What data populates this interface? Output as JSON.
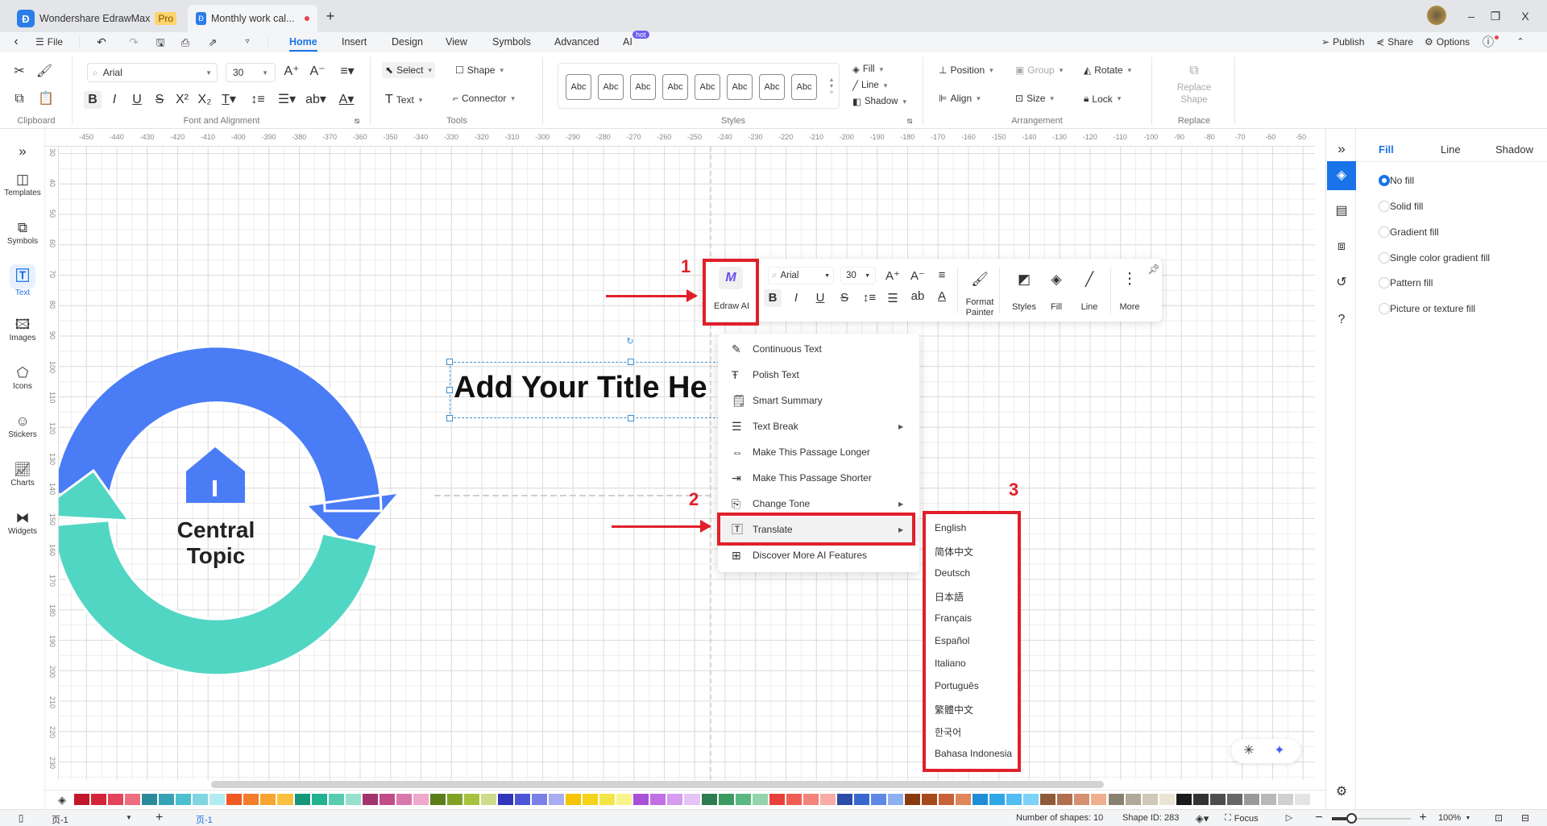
{
  "titlebar": {
    "app_name": "Wondershare EdrawMax",
    "pro_badge": "Pro",
    "doc_tab": "Monthly work cal...",
    "new_tab": "+",
    "minimize": "–",
    "maximize": "❐",
    "close": "X"
  },
  "menubar": {
    "file": "File",
    "tabs": [
      "Home",
      "Insert",
      "Design",
      "View",
      "Symbols",
      "Advanced",
      "AI"
    ],
    "active_tab": "Home",
    "ai_badge": "hot",
    "publish": "Publish",
    "share": "Share",
    "options": "Options"
  },
  "ribbon": {
    "groups": {
      "clipboard": "Clipboard",
      "font": "Font and Alignment",
      "tools": "Tools",
      "styles": "Styles",
      "arrangement": "Arrangement",
      "replace": "Replace"
    },
    "font_name": "Arial",
    "font_size": "30",
    "tools": {
      "select": "Select",
      "shape": "Shape",
      "text": "Text",
      "connector": "Connector"
    },
    "style_swatches": [
      "Abc",
      "Abc",
      "Abc",
      "Abc",
      "Abc",
      "Abc",
      "Abc",
      "Abc"
    ],
    "fill": "Fill",
    "line": "Line",
    "shadow": "Shadow",
    "arrangement": {
      "position": "Position",
      "group": "Group",
      "rotate": "Rotate",
      "align": "Align",
      "size": "Size",
      "lock": "Lock"
    },
    "replace_shape": "Replace Shape"
  },
  "left_sidebar": {
    "items": [
      {
        "label": "Templates"
      },
      {
        "label": "Symbols"
      },
      {
        "label": "Text"
      },
      {
        "label": "Images"
      },
      {
        "label": "Icons"
      },
      {
        "label": "Stickers"
      },
      {
        "label": "Charts"
      },
      {
        "label": "Widgets"
      }
    ],
    "active": "Text"
  },
  "rulers": {
    "horizontal": [
      -450,
      -440,
      -430,
      -420,
      -410,
      -400,
      -390,
      -380,
      -370,
      -360,
      -350,
      -340,
      -330,
      -320,
      -310,
      -300,
      -290,
      -280,
      -270,
      -260,
      -250,
      -240,
      -230,
      -220,
      -210,
      -200,
      -190,
      -180,
      -170,
      -160,
      -150,
      -140,
      -130,
      -120,
      -110,
      -100,
      -90,
      -80,
      -70,
      -60,
      -50
    ],
    "vertical": [
      30,
      40,
      50,
      60,
      70,
      80,
      90,
      100,
      110,
      120,
      130,
      140,
      150,
      160,
      170,
      180,
      190,
      200,
      210,
      220,
      230
    ]
  },
  "canvas": {
    "title_text": "Add Your Title He",
    "central_topic": "Central Topic",
    "colors": {
      "blue": "#4a7cf6",
      "teal": "#52d6c4"
    }
  },
  "floating_toolbar": {
    "edraw_ai": "Edraw AI",
    "font_name": "Arial",
    "font_size": "30",
    "format_painter": "Format Painter",
    "styles": "Styles",
    "fill": "Fill",
    "line": "Line",
    "more": "More"
  },
  "ai_menu": {
    "items": [
      {
        "label": "Continuous Text",
        "icon": "pen-lines-icon"
      },
      {
        "label": "Polish Text",
        "icon": "text-sparkle-icon"
      },
      {
        "label": "Smart Summary",
        "icon": "summary-icon"
      },
      {
        "label": "Text Break",
        "icon": "list-icon",
        "submenu": true
      },
      {
        "label": "Make This Passage Longer",
        "icon": "expand-text-icon"
      },
      {
        "label": "Make This Passage Shorter",
        "icon": "shorten-text-icon"
      },
      {
        "label": "Change Tone",
        "icon": "tone-icon",
        "submenu": true
      },
      {
        "label": "Translate",
        "icon": "translate-icon",
        "submenu": true,
        "highlighted": true
      },
      {
        "label": "Discover More AI Features",
        "icon": "plus-box-icon"
      }
    ]
  },
  "translate_submenu": {
    "items": [
      "English",
      "简体中文",
      "Deutsch",
      "日本語",
      "Français",
      "Español",
      "Italiano",
      "Português",
      "繁體中文",
      "한국어",
      "Bahasa Indonesia"
    ]
  },
  "annotations": {
    "step1": "1",
    "step2": "2",
    "step3": "3",
    "color": "#e0202a"
  },
  "right_panel": {
    "tabs": [
      "Fill",
      "Line",
      "Shadow"
    ],
    "active_tab": "Fill",
    "fill_options": [
      "No fill",
      "Solid fill",
      "Gradient fill",
      "Single color gradient fill",
      "Pattern fill",
      "Picture or texture fill"
    ],
    "selected_option": "No fill"
  },
  "palette": [
    "#c0182a",
    "#d3243a",
    "#e4435a",
    "#ee6d80",
    "#2b8a9a",
    "#36a3b4",
    "#4cc0cf",
    "#7fd6e0",
    "#b3ecf2",
    "#f05a22",
    "#f57c2a",
    "#f7a531",
    "#fbc03f",
    "#17977a",
    "#22b191",
    "#57cdb0",
    "#96e0cc",
    "#a3336e",
    "#c24c8a",
    "#d978ad",
    "#f0a8cb",
    "#5a7d1a",
    "#7fa124",
    "#a7c23e",
    "#cddc8a",
    "#3336b8",
    "#4d55d6",
    "#7a80e6",
    "#a9acf0",
    "#f6c500",
    "#f4d31a",
    "#f5e445",
    "#f9f38c",
    "#a94fd8",
    "#c170e6",
    "#d59cf0",
    "#e6c4f6",
    "#2e7d4f",
    "#3d9a62",
    "#5bb883",
    "#93d4ac",
    "#e8403a",
    "#ef5e55",
    "#f3837b",
    "#f7aca6",
    "#2b4ba8",
    "#3a66d0",
    "#5c88e6",
    "#8fb0f0",
    "#8a3a0f",
    "#a64a1b",
    "#c86238",
    "#e0865c",
    "#1e8ed6",
    "#2ea6e8",
    "#52bdf2",
    "#7dd3f7",
    "#8e5a3a",
    "#b07050",
    "#d49070",
    "#f0b090",
    "#8a8070",
    "#b0a898",
    "#d0c8b8",
    "#eae4d4",
    "#1a1a1a",
    "#333333",
    "#4d4d4d",
    "#666666",
    "#999999",
    "#b8b8b8",
    "#d0d0d0",
    "#e4e4e4"
  ],
  "statusbar": {
    "page_select": "页-1",
    "add_page": "+",
    "active_page": "页-1",
    "shape_count": "Number of shapes: 10",
    "shape_id": "Shape ID: 283",
    "focus": "Focus",
    "zoom": "100%",
    "zoom_level": 100
  }
}
